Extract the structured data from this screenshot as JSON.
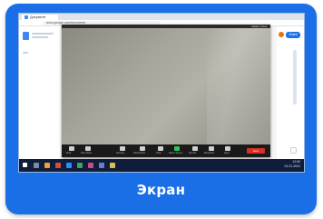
{
  "card": {
    "caption": "Экран"
  },
  "browser": {
    "tab_title": "Документ",
    "address": "docs.google.com/document"
  },
  "docs": {
    "share_label": "Share"
  },
  "video": {
    "top_label": "Gallery View",
    "controls": [
      {
        "icon": "mute-icon",
        "label": "Mute"
      },
      {
        "icon": "video-icon",
        "label": "Stop Video"
      },
      {
        "icon": "security-icon",
        "label": "Security"
      },
      {
        "icon": "participants-icon",
        "label": "Participants"
      },
      {
        "icon": "chat-icon",
        "label": "Chat"
      },
      {
        "icon": "share-screen-icon",
        "label": "Share Screen"
      },
      {
        "icon": "record-icon",
        "label": "Record"
      },
      {
        "icon": "reactions-icon",
        "label": "Reactions"
      },
      {
        "icon": "apps-icon",
        "label": "Apps"
      }
    ],
    "end_label": "End"
  },
  "taskbar": {
    "time": "12:00",
    "date": "01.01.2021"
  },
  "colors": {
    "card_bg": "#1a6ee6",
    "caption": "#ffffff"
  }
}
